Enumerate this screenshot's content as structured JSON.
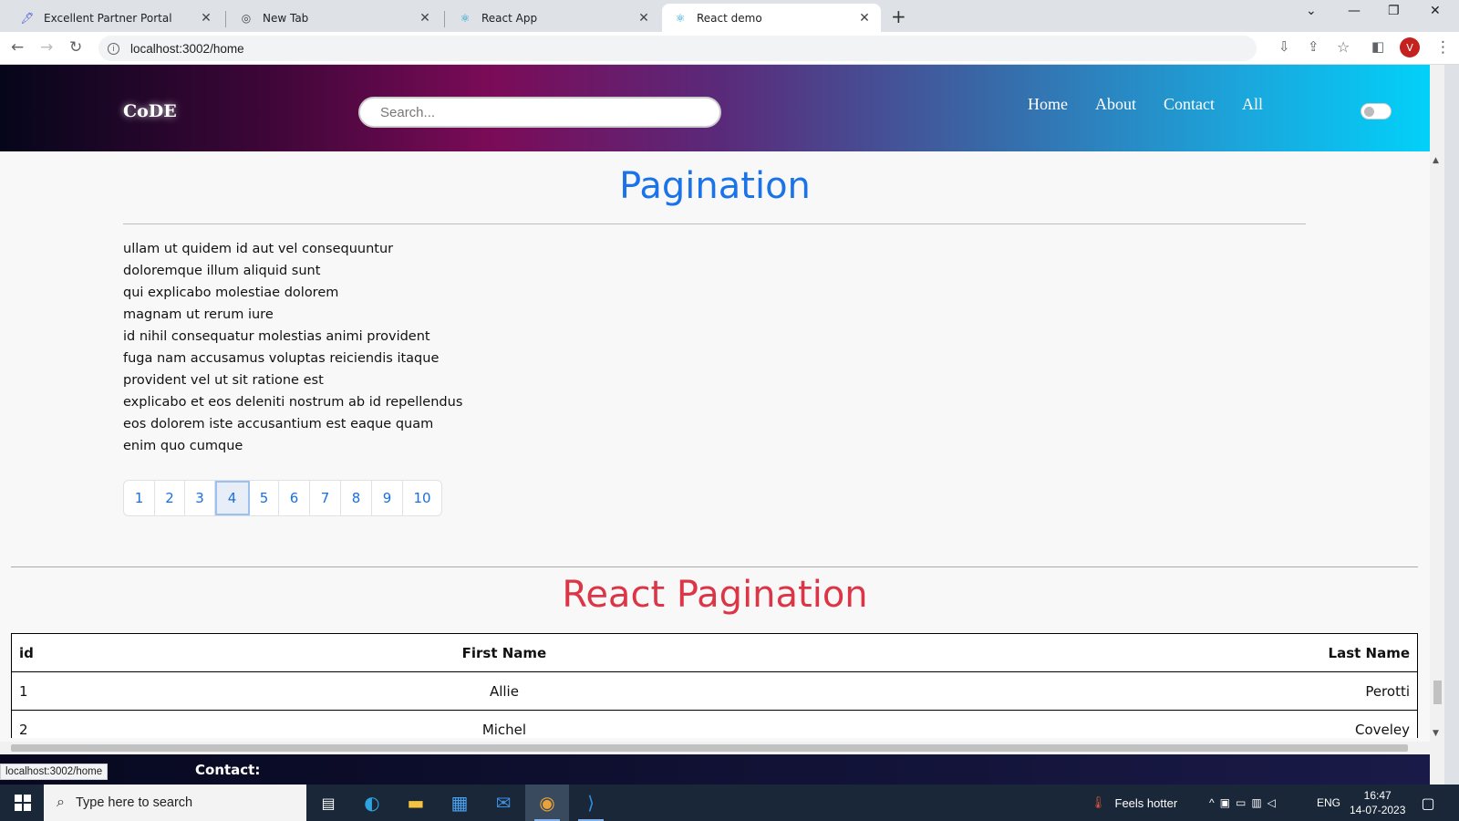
{
  "browser": {
    "tabs": [
      {
        "title": "Excellent Partner Portal",
        "icon": "portal-icon"
      },
      {
        "title": "New Tab",
        "icon": "chrome-icon"
      },
      {
        "title": "React App",
        "icon": "react-icon"
      },
      {
        "title": "React demo",
        "icon": "react-icon",
        "active": true
      }
    ],
    "url": "localhost:3002/home",
    "profile_initial": "V",
    "status_url": "localhost:3002/home"
  },
  "navbar": {
    "brand": "CoDE",
    "search_placeholder": "Search...",
    "links": [
      "Home",
      "About",
      "Contact",
      "All"
    ]
  },
  "pagination_section": {
    "title": "Pagination",
    "posts": [
      "ullam ut quidem id aut vel consequuntur",
      "doloremque illum aliquid sunt",
      "qui explicabo molestiae dolorem",
      "magnam ut rerum iure",
      "id nihil consequatur molestias animi provident",
      "fuga nam accusamus voluptas reiciendis itaque",
      "provident vel ut sit ratione est",
      "explicabo et eos deleniti nostrum ab id repellendus",
      "eos dolorem iste accusantium est eaque quam",
      "enim quo cumque"
    ],
    "pages": [
      "1",
      "2",
      "3",
      "4",
      "5",
      "6",
      "7",
      "8",
      "9",
      "10"
    ],
    "active_page": "4"
  },
  "react_pagination": {
    "title": "React Pagination",
    "columns": [
      "id",
      "First Name",
      "Last Name"
    ],
    "rows": [
      [
        "1",
        "Allie",
        "Perotti"
      ],
      [
        "2",
        "Michel",
        "Coveley"
      ]
    ]
  },
  "footer": {
    "contact_label": "Contact:"
  },
  "taskbar": {
    "search_placeholder": "Type here to search",
    "weather": "Feels hotter",
    "lang": "ENG",
    "time": "16:47",
    "date": "14-07-2023"
  },
  "colors": {
    "accent_blue": "#1a73e8",
    "accent_red": "#dc3545"
  }
}
